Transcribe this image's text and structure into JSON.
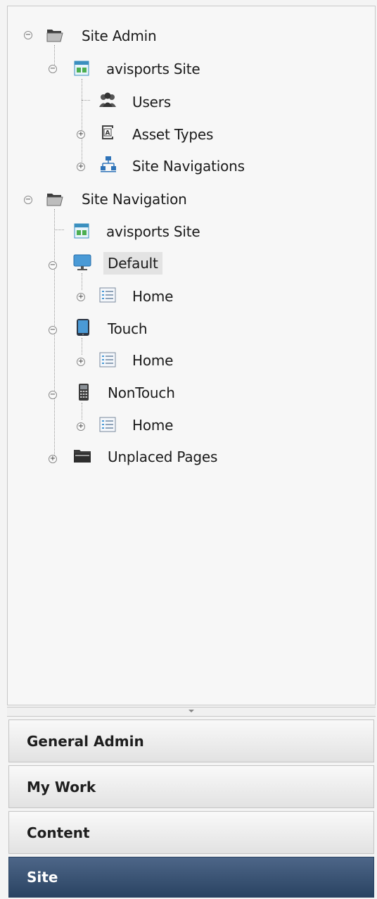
{
  "tree": {
    "site_admin": {
      "label": "Site Admin",
      "site": "avisports Site",
      "users": "Users",
      "asset_types": "Asset Types",
      "site_navigations": "Site Navigations"
    },
    "site_navigation": {
      "label": "Site Navigation",
      "site": "avisports Site",
      "default": "Default",
      "default_home": "Home",
      "touch": "Touch",
      "touch_home": "Home",
      "nontouch": "NonTouch",
      "nontouch_home": "Home",
      "unplaced": "Unplaced Pages"
    }
  },
  "accordion": {
    "general_admin": "General Admin",
    "my_work": "My Work",
    "content": "Content",
    "site": "Site"
  },
  "icons": [
    "folder-open-icon",
    "site-icon",
    "users-icon",
    "asset-types-icon",
    "site-navigations-icon",
    "desktop-icon",
    "page-icon",
    "tablet-icon",
    "phone-icon",
    "folder-icon"
  ],
  "colors": {
    "active_tab": "#2f4a6c",
    "selected_node": "#e3e3e3"
  },
  "selected": "Default"
}
